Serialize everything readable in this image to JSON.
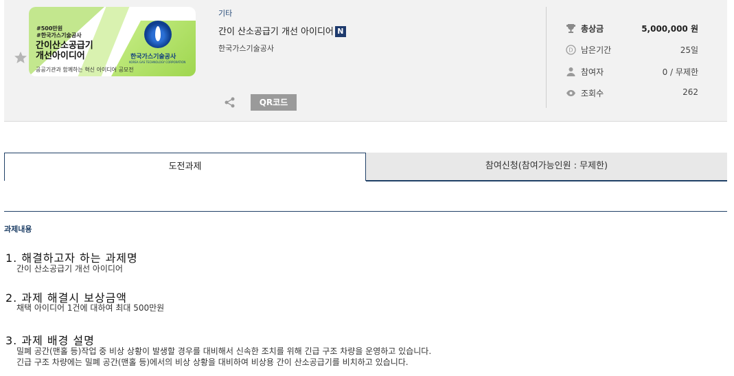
{
  "banner": {
    "tag1": "#500만원",
    "tag2": "#한국가스기술공사",
    "title_line1": "간이산소공급기",
    "title_line2": "개선아이디어",
    "subtitle": "공공기관과 함께하는 혁신 아이디어 공모전",
    "logo_text": "한국가스기술공사",
    "logo_en": "KOREA GAS TECHNOLOGY CORPORATION"
  },
  "contest": {
    "category": "기타",
    "title": "간이 산소공급기 개선 아이디어",
    "new_badge": "N",
    "organizer": "한국가스기술공사",
    "qr_label": "QR코드"
  },
  "stats": [
    {
      "icon": "trophy-icon",
      "label": "총상금",
      "value": "5,000,000 원"
    },
    {
      "icon": "d-day-icon",
      "label": "남은기간",
      "value": "25일"
    },
    {
      "icon": "person-icon",
      "label": "참여자",
      "value": "0 / 무제한"
    },
    {
      "icon": "eye-icon",
      "label": "조회수",
      "value": "262"
    }
  ],
  "tabs": [
    {
      "label": "도전과제",
      "active": true
    },
    {
      "label": "참여신청(참여가능인원 : 무제한)",
      "active": false
    }
  ],
  "content": {
    "section_label": "과제내용",
    "items": [
      {
        "heading": "1.  해결하고자 하는 과제명",
        "lines": [
          "간이 산소공급기 개선 아이디어"
        ]
      },
      {
        "heading": "2.  과제 해결시 보상금액",
        "lines": [
          "채택 아이디어 1건에 대하여 최대 500만원"
        ]
      },
      {
        "heading": "3.  과제 배경 설명",
        "lines": [
          "밀폐 공간(맨홀 등)작업 중 비상 상황이 발생할 경우를 대비해서 신속한 조치를 위해 긴급 구조 차량을 운영하고 있습니다.",
          "긴급 구조 차량에는 밀폐 공간(맨홀 등)에서의 비상 상황을 대비하여 비상용 간이 산소공급기를 비치하고 있습니다."
        ]
      }
    ]
  },
  "colors": {
    "accent": "#1e3f66",
    "qr_button": "#9a9a9a",
    "header_bg": "#f2f2f2"
  }
}
